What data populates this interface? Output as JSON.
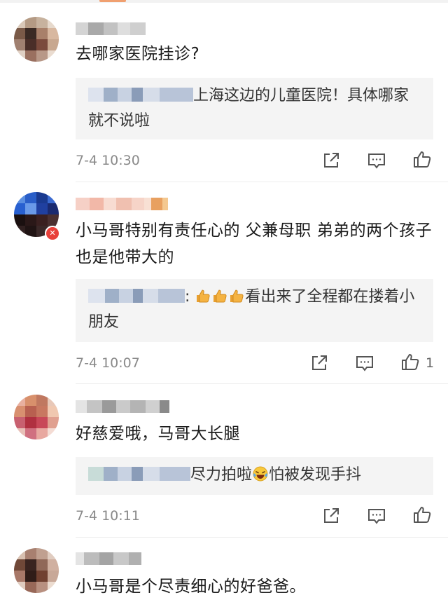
{
  "comments": [
    {
      "text": "去哪家医院挂诊?",
      "reply_text": "上海这边的儿童医院！具体哪家就不说啦",
      "time": "7-4 10:30",
      "likes": ""
    },
    {
      "text": "小马哥特别有责任心的 父兼母职 弟弟的两个孩子也是他带大的",
      "reply_prefix": ":",
      "reply_text": "看出来了全程都在搂着小朋友",
      "time": "7-4 10:07",
      "likes": "1"
    },
    {
      "text": "好慈爱哦，马哥大长腿",
      "reply_text_a": "尽力拍啦",
      "reply_text_b": "怕被发现手抖",
      "time": "7-4 10:11",
      "likes": ""
    },
    {
      "text": "小马哥是个尽责细心的好爸爸。"
    }
  ],
  "icons": {
    "share": "share-icon",
    "reply": "comment-icon",
    "like": "thumbs-up-icon",
    "thumbs_emoji": "thumbs-up-emoji",
    "laugh_cry_emoji": "laughing-crying-emoji"
  },
  "colors": {
    "reply_bg": "#f4f4f4",
    "time": "#8a8a8a",
    "badge": "#e8403a"
  }
}
